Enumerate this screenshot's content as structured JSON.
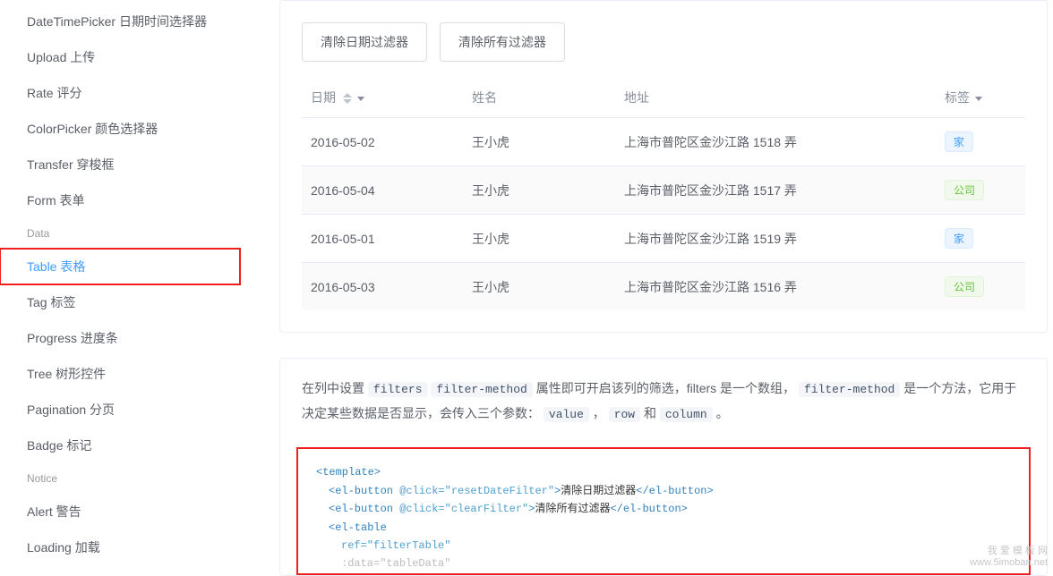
{
  "sidebar": {
    "items": [
      {
        "label": "DateTimePicker 日期时间选择器"
      },
      {
        "label": "Upload 上传"
      },
      {
        "label": "Rate 评分"
      },
      {
        "label": "ColorPicker 颜色选择器"
      },
      {
        "label": "Transfer 穿梭框"
      },
      {
        "label": "Form 表单"
      }
    ],
    "group_data": "Data",
    "items2": [
      {
        "label": "Table 表格"
      },
      {
        "label": "Tag 标签"
      },
      {
        "label": "Progress 进度条"
      },
      {
        "label": "Tree 树形控件"
      },
      {
        "label": "Pagination 分页"
      },
      {
        "label": "Badge 标记"
      }
    ],
    "group_notice": "Notice",
    "items3": [
      {
        "label": "Alert 警告"
      },
      {
        "label": "Loading 加载"
      }
    ]
  },
  "toolbar": {
    "reset_date": "清除日期过滤器",
    "clear_all": "清除所有过滤器"
  },
  "table": {
    "headers": {
      "date": "日期",
      "name": "姓名",
      "address": "地址",
      "tag": "标签"
    },
    "rows": [
      {
        "date": "2016-05-02",
        "name": "王小虎",
        "address": "上海市普陀区金沙江路 1518 弄",
        "tag": "家",
        "tag_type": "primary"
      },
      {
        "date": "2016-05-04",
        "name": "王小虎",
        "address": "上海市普陀区金沙江路 1517 弄",
        "tag": "公司",
        "tag_type": "success"
      },
      {
        "date": "2016-05-01",
        "name": "王小虎",
        "address": "上海市普陀区金沙江路 1519 弄",
        "tag": "家",
        "tag_type": "primary"
      },
      {
        "date": "2016-05-03",
        "name": "王小虎",
        "address": "上海市普陀区金沙江路 1516 弄",
        "tag": "公司",
        "tag_type": "success"
      }
    ]
  },
  "desc": {
    "p1_a": "在列中设置",
    "c1": "filters",
    "c2": "filter-method",
    "p1_b": "属性即可开启该列的筛选，filters 是一个数组，",
    "c3": "filter-method",
    "p1_c": "是一个方法，它用于决定某些数据是否显示，会传入三个参数：",
    "c4": "value",
    "comma1": "，",
    "c5": "row",
    "and": "和",
    "c6": "column",
    "dot": "。"
  },
  "code": {
    "l1_open": "<template>",
    "l2_open": "<el-button",
    "l2_attr": " @click=\"resetDateFilter\"",
    "l2_close": ">",
    "l2_text": "清除日期过滤器",
    "l2_end": "</el-button>",
    "l3_open": "<el-button",
    "l3_attr": " @click=\"clearFilter\"",
    "l3_close": ">",
    "l3_text": "清除所有过滤器",
    "l3_end": "</el-button>",
    "l4": "<el-table",
    "l5_attr": "ref",
    "l5_val": "=\"filterTable\"",
    "l6_attr": ":data",
    "l6_val": "=\"tableData\""
  },
  "watermark": {
    "l1": "我 爱 模 板 网",
    "l2": "www.5imoban.net"
  }
}
